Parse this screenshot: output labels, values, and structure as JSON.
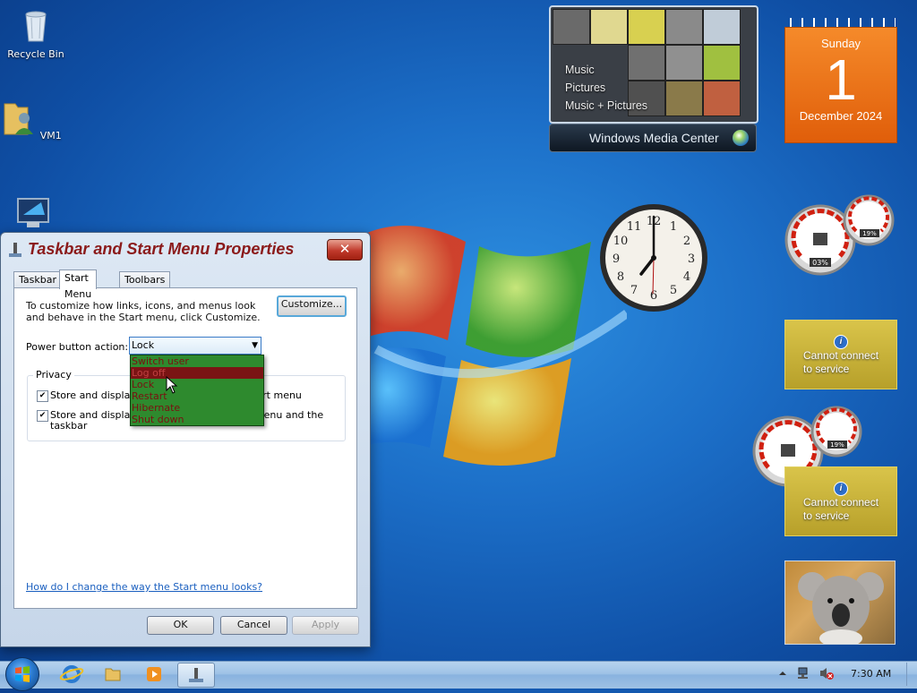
{
  "desktop": {
    "icons": [
      {
        "label": "Recycle Bin"
      },
      {
        "label": "VM1"
      }
    ]
  },
  "media_center": {
    "menu": [
      "Music",
      "Pictures",
      "Music + Pictures"
    ],
    "bar_label": "Windows Media Center"
  },
  "calendar": {
    "weekday": "Sunday",
    "day": "1",
    "month_year": "December 2024"
  },
  "cpu_meter_1": {
    "left_value": "03%",
    "right_value": "19%"
  },
  "cpu_meter_2": {
    "left_value": "",
    "right_value": "19%"
  },
  "weather": [
    {
      "message_line1": "Cannot connect",
      "message_line2": "to service"
    },
    {
      "message_line1": "Cannot connect",
      "message_line2": "to service"
    }
  ],
  "dialog": {
    "title": "Taskbar and Start Menu Properties",
    "close_label": "✕",
    "tabs": [
      {
        "label": "Taskbar"
      },
      {
        "label": "Start Menu"
      },
      {
        "label": "Toolbars"
      }
    ],
    "description": "To customize how links, icons, and menus look and behave in the Start menu, click Customize.",
    "customize_label": "Customize...",
    "power_label": "Power button action:",
    "power_value": "Lock",
    "power_options": [
      "Switch user",
      "Log off",
      "Lock",
      "Restart",
      "Hibernate",
      "Shut down"
    ],
    "privacy_label": "Privacy",
    "privacy_items": [
      {
        "text_before": "Store and display r",
        "text_after": "e Start menu"
      },
      {
        "text_before": "Store and display r",
        "text_after": "art menu and the",
        "text_line2": "taskbar"
      }
    ],
    "help_link": "How do I change the way the Start menu looks?",
    "ok_label": "OK",
    "cancel_label": "Cancel",
    "apply_label": "Apply"
  },
  "taskbar": {
    "time": "7:30 AM"
  },
  "colors": {
    "dialog_title": "#8b1a1a",
    "dropdown_bg": "#2e8a2e",
    "dropdown_selected": "#7a1414",
    "calendar": "#f0741a",
    "weather_tile": "#c8b33a"
  }
}
